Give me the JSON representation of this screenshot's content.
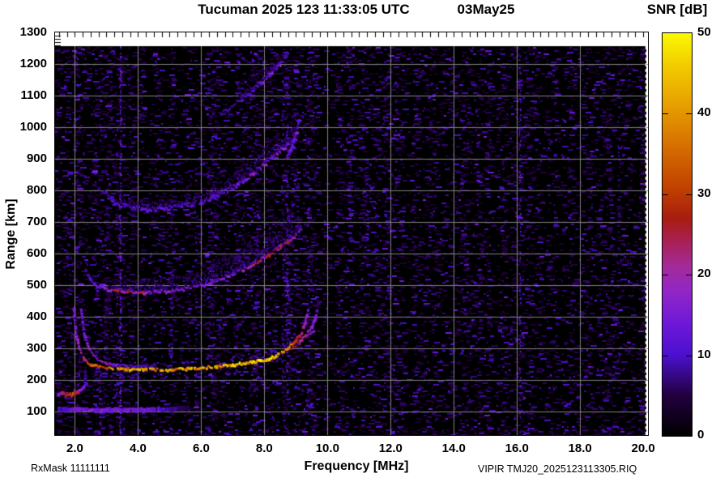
{
  "chart_data": {
    "type": "heatmap",
    "subtype": "ionogram",
    "title": "Tucuman 2025 123 11:33:05 UTC",
    "date_label": "03May25",
    "xlabel": "Frequency [MHz]",
    "ylabel": "Range [km]",
    "xlim": [
      1.372,
      20.15
    ],
    "ylim": [
      25.6,
      1300
    ],
    "data_top_km": 1256,
    "data_right_mhz": 20.08,
    "x_ticks": {
      "values": [
        2,
        4,
        6,
        8,
        10,
        12,
        14,
        16,
        18,
        20
      ],
      "labels": [
        "2.0",
        "4.0",
        "6.0",
        "8.0",
        "10.0",
        "12.0",
        "14.0",
        "16.0",
        "18.0",
        "20.0"
      ]
    },
    "y_ticks": {
      "values": [
        100,
        200,
        300,
        400,
        500,
        600,
        700,
        800,
        900,
        1000,
        1100,
        1200,
        1300
      ]
    },
    "x_gridlines": [
      2,
      4,
      6,
      8,
      10,
      12,
      14,
      16,
      18
    ],
    "y_gridlines": [
      100,
      200,
      300,
      400,
      500,
      600,
      700,
      800,
      900,
      1000,
      1100,
      1200
    ],
    "grid_color": "#818181",
    "bg_color": "#000000",
    "frame_color": "#000000",
    "right_edge_dash_color": "#ffffff",
    "notes": {
      "rx_mask": "RxMask 11111111",
      "file_label": "VIPIR  TMJ20_2025123113305.RIQ"
    },
    "colorbar": {
      "title": "SNR [dB]",
      "min": 0,
      "max": 50,
      "tick_values": [
        0,
        10,
        20,
        30,
        40,
        50
      ],
      "marked_ticks": [
        10,
        20,
        30,
        40
      ],
      "palette": [
        [
          0.0,
          "#000000"
        ],
        [
          0.1,
          "#22003e"
        ],
        [
          0.2,
          "#4c10ce"
        ],
        [
          0.28,
          "#6f18d8"
        ],
        [
          0.36,
          "#9226c6"
        ],
        [
          0.42,
          "#a42b9a"
        ],
        [
          0.48,
          "#a82158"
        ],
        [
          0.54,
          "#a81c10"
        ],
        [
          0.62,
          "#c24300"
        ],
        [
          0.72,
          "#d66f00"
        ],
        [
          0.82,
          "#e69e00"
        ],
        [
          0.92,
          "#f2cc00"
        ],
        [
          1.0,
          "#fbf800"
        ]
      ]
    },
    "traces": [
      {
        "name": "F-1hop-O-mode",
        "thickness": 3,
        "jitter": 3,
        "halo": true,
        "points": [
          [
            1.98,
            425
          ],
          [
            2.05,
            345
          ],
          [
            2.15,
            298
          ],
          [
            2.3,
            266
          ],
          [
            2.5,
            249
          ],
          [
            2.8,
            241
          ],
          [
            3.2,
            236
          ],
          [
            4.0,
            233
          ],
          [
            5.0,
            233
          ],
          [
            5.8,
            236
          ],
          [
            6.5,
            242
          ],
          [
            7.0,
            248
          ],
          [
            7.5,
            255
          ],
          [
            8.0,
            262
          ],
          [
            8.4,
            276
          ],
          [
            8.7,
            296
          ],
          [
            9.0,
            322
          ],
          [
            9.2,
            352
          ],
          [
            9.32,
            388
          ],
          [
            9.4,
            422
          ]
        ],
        "snr": [
          [
            1.98,
            15
          ],
          [
            2.2,
            20
          ],
          [
            2.5,
            30
          ],
          [
            2.8,
            35
          ],
          [
            3.2,
            38
          ],
          [
            5.0,
            39
          ],
          [
            6.5,
            41
          ],
          [
            7.3,
            44
          ],
          [
            8.0,
            44
          ],
          [
            8.5,
            42
          ],
          [
            8.8,
            37
          ],
          [
            9.0,
            29
          ],
          [
            9.2,
            23
          ],
          [
            9.4,
            17
          ]
        ],
        "spots": [
          [
            3.4,
            40
          ],
          [
            4.2,
            41
          ],
          [
            5.6,
            41
          ],
          [
            7.6,
            46
          ],
          [
            8.0,
            46
          ],
          [
            8.3,
            45
          ]
        ]
      },
      {
        "name": "F-1hop-X-low",
        "thickness": 2,
        "jitter": 2,
        "halo": false,
        "points": [
          [
            2.2,
            425
          ],
          [
            2.3,
            345
          ],
          [
            2.45,
            298
          ],
          [
            2.65,
            270
          ],
          [
            2.9,
            254
          ],
          [
            3.3,
            247
          ],
          [
            3.9,
            244
          ],
          [
            4.6,
            243
          ]
        ],
        "snr": [
          [
            2.2,
            13
          ],
          [
            2.5,
            17
          ],
          [
            2.9,
            19
          ],
          [
            3.5,
            13
          ],
          [
            4.6,
            7
          ]
        ]
      },
      {
        "name": "F-1hop-X-high",
        "thickness": 2.5,
        "jitter": 2,
        "halo": false,
        "points": [
          [
            8.85,
            298
          ],
          [
            9.1,
            316
          ],
          [
            9.3,
            340
          ],
          [
            9.5,
            366
          ],
          [
            9.62,
            395
          ],
          [
            9.68,
            422
          ]
        ],
        "snr": [
          [
            8.85,
            26
          ],
          [
            9.2,
            24
          ],
          [
            9.5,
            18
          ],
          [
            9.68,
            13
          ]
        ]
      },
      {
        "name": "F-1hop-stub",
        "thickness": 2,
        "jitter": 2,
        "halo": false,
        "points": [
          [
            9.12,
            326
          ],
          [
            9.35,
            340
          ],
          [
            9.58,
            355
          ]
        ],
        "snr": [
          [
            9.12,
            20
          ],
          [
            9.58,
            16
          ]
        ]
      },
      {
        "name": "F-2hop",
        "thickness": 3,
        "jitter": 4,
        "halo": true,
        "points": [
          [
            2.35,
            548
          ],
          [
            2.5,
            515
          ],
          [
            2.7,
            497
          ],
          [
            3.0,
            487
          ],
          [
            3.5,
            480
          ],
          [
            4.2,
            477
          ],
          [
            5.0,
            481
          ],
          [
            5.5,
            488
          ],
          [
            6.0,
            498
          ],
          [
            6.5,
            513
          ],
          [
            7.0,
            533
          ],
          [
            7.5,
            558
          ],
          [
            8.0,
            586
          ],
          [
            8.5,
            620
          ],
          [
            8.9,
            650
          ],
          [
            9.15,
            672
          ]
        ],
        "snr": [
          [
            2.35,
            9
          ],
          [
            2.7,
            13
          ],
          [
            3.2,
            17
          ],
          [
            4.0,
            19
          ],
          [
            4.6,
            17
          ],
          [
            5.5,
            14
          ],
          [
            6.5,
            15
          ],
          [
            7.2,
            17
          ],
          [
            7.8,
            21
          ],
          [
            8.3,
            23
          ],
          [
            8.8,
            21
          ],
          [
            9.15,
            15
          ]
        ],
        "spots": [
          [
            3.3,
            26
          ],
          [
            3.7,
            27
          ],
          [
            4.1,
            26
          ],
          [
            7.7,
            28
          ],
          [
            8.1,
            28
          ],
          [
            8.45,
            27
          ],
          [
            8.7,
            26
          ]
        ],
        "spread": [
          [
            3.0,
            28
          ],
          [
            4.0,
            38
          ],
          [
            5.0,
            45
          ],
          [
            6.0,
            55
          ],
          [
            6.5,
            65
          ],
          [
            7.0,
            75
          ],
          [
            7.5,
            85
          ],
          [
            8.0,
            90
          ],
          [
            8.5,
            85
          ],
          [
            9.0,
            68
          ],
          [
            9.15,
            40
          ]
        ]
      },
      {
        "name": "F-3hop",
        "thickness": 3,
        "jitter": 5,
        "halo": false,
        "points": [
          [
            2.9,
            800
          ],
          [
            3.2,
            763
          ],
          [
            3.6,
            748
          ],
          [
            4.3,
            740
          ],
          [
            5.0,
            744
          ],
          [
            5.6,
            753
          ],
          [
            6.0,
            763
          ],
          [
            6.5,
            781
          ],
          [
            7.0,
            808
          ],
          [
            7.5,
            842
          ],
          [
            8.0,
            882
          ],
          [
            8.5,
            925
          ],
          [
            9.0,
            962
          ]
        ],
        "snr": [
          [
            2.9,
            8
          ],
          [
            3.5,
            11
          ],
          [
            4.5,
            13
          ],
          [
            5.5,
            11
          ],
          [
            6.5,
            12
          ],
          [
            7.5,
            14
          ],
          [
            8.3,
            15
          ],
          [
            9.0,
            11
          ]
        ],
        "spots": [
          [
            7.6,
            20
          ],
          [
            8.0,
            21
          ],
          [
            8.35,
            22
          ],
          [
            8.6,
            19
          ]
        ],
        "spread": [
          [
            3.2,
            18
          ],
          [
            5.0,
            26
          ],
          [
            6.5,
            38
          ],
          [
            7.5,
            52
          ],
          [
            8.3,
            60
          ],
          [
            9.0,
            42
          ]
        ]
      },
      {
        "name": "F-4hop",
        "thickness": 2.5,
        "jitter": 5,
        "halo": false,
        "points": [
          [
            6.6,
            1040
          ],
          [
            7.0,
            1068
          ],
          [
            7.4,
            1098
          ],
          [
            7.8,
            1132
          ],
          [
            8.2,
            1168
          ],
          [
            8.55,
            1205
          ],
          [
            8.72,
            1230
          ]
        ],
        "snr": [
          [
            6.6,
            7
          ],
          [
            7.2,
            9
          ],
          [
            7.8,
            12
          ],
          [
            8.3,
            13
          ],
          [
            8.72,
            9
          ]
        ],
        "spots": [
          [
            7.9,
            16
          ],
          [
            8.2,
            17
          ],
          [
            8.45,
            16
          ]
        ],
        "spread": [
          [
            7.2,
            18
          ],
          [
            8.0,
            32
          ],
          [
            8.6,
            28
          ]
        ]
      },
      {
        "name": "F-4hop-steep",
        "thickness": 2.5,
        "jitter": 4,
        "halo": false,
        "points": [
          [
            8.75,
            905
          ],
          [
            8.85,
            932
          ],
          [
            8.95,
            962
          ],
          [
            9.05,
            998
          ],
          [
            9.12,
            1025
          ]
        ],
        "snr": [
          [
            8.75,
            12
          ],
          [
            9.0,
            14
          ],
          [
            9.12,
            10
          ]
        ],
        "spots": [
          [
            9.0,
            16
          ]
        ]
      },
      {
        "name": "E-layer",
        "thickness": 5,
        "jitter": 2,
        "halo": false,
        "points": [
          [
            1.5,
            107
          ],
          [
            2.2,
            106
          ],
          [
            3.0,
            105
          ],
          [
            4.0,
            105
          ],
          [
            4.6,
            106
          ],
          [
            5.2,
            109
          ],
          [
            5.6,
            112
          ]
        ],
        "snr": [
          [
            1.5,
            10
          ],
          [
            1.8,
            13
          ],
          [
            2.2,
            15
          ],
          [
            3.0,
            14
          ],
          [
            3.8,
            14
          ],
          [
            4.5,
            12
          ],
          [
            5.0,
            8
          ],
          [
            5.6,
            5
          ]
        ],
        "spots": [
          [
            2.1,
            16
          ],
          [
            2.5,
            17
          ],
          [
            2.9,
            16
          ],
          [
            3.3,
            16
          ]
        ]
      },
      {
        "name": "low-freq-blob",
        "thickness": 4,
        "jitter": 3,
        "halo": true,
        "points": [
          [
            1.45,
            150
          ],
          [
            1.6,
            158
          ],
          [
            1.75,
            154
          ],
          [
            1.9,
            152
          ],
          [
            2.0,
            158
          ],
          [
            2.1,
            165
          ],
          [
            2.2,
            172
          ],
          [
            2.3,
            183
          ],
          [
            2.36,
            192
          ]
        ],
        "snr": [
          [
            1.45,
            13
          ],
          [
            1.6,
            20
          ],
          [
            1.75,
            26
          ],
          [
            1.95,
            30
          ],
          [
            2.05,
            24
          ],
          [
            2.2,
            16
          ],
          [
            2.36,
            11
          ]
        ]
      },
      {
        "name": "blob-tail",
        "thickness": 2,
        "jitter": 2,
        "halo": false,
        "points": [
          [
            2.32,
            192
          ],
          [
            2.34,
            212
          ],
          [
            2.33,
            230
          ]
        ],
        "snr": [
          [
            2.32,
            10
          ],
          [
            2.33,
            8
          ]
        ]
      }
    ],
    "rfi_columns": [
      {
        "f": 2.78,
        "km": [
          60,
          230
        ],
        "prob": 0.4,
        "snr": 11,
        "width": 2
      },
      {
        "f": 2.9,
        "km": [
          60,
          600
        ],
        "prob": 0.15,
        "snr": 8,
        "width": 2
      },
      {
        "f": 3.42,
        "km": [
          30,
          1256
        ],
        "prob": 0.55,
        "snr": 13,
        "width": 2
      },
      {
        "f": 3.32,
        "km": [
          100,
          1100
        ],
        "prob": 0.16,
        "snr": 8,
        "width": 2
      },
      {
        "f": 4.35,
        "km": [
          150,
          900
        ],
        "prob": 0.14,
        "snr": 8,
        "width": 2
      },
      {
        "f": 5.05,
        "km": [
          150,
          800
        ],
        "prob": 0.14,
        "snr": 8,
        "width": 2
      },
      {
        "f": 5.8,
        "km": [
          150,
          900
        ],
        "prob": 0.17,
        "snr": 9,
        "width": 2
      },
      {
        "f": 6.3,
        "km": [
          300,
          1000
        ],
        "prob": 0.12,
        "snr": 8,
        "width": 2
      },
      {
        "f": 7.3,
        "km": [
          300,
          1150
        ],
        "prob": 0.12,
        "snr": 8,
        "width": 2
      },
      {
        "f": 8.55,
        "km": [
          150,
          1250
        ],
        "prob": 0.2,
        "snr": 10,
        "width": 2
      },
      {
        "f": 8.7,
        "km": [
          150,
          1250
        ],
        "prob": 0.28,
        "snr": 11,
        "width": 2
      },
      {
        "f": 9.37,
        "km": [
          150,
          1100
        ],
        "prob": 0.17,
        "snr": 9,
        "width": 2
      },
      {
        "f": 10.65,
        "km": [
          550,
          980
        ],
        "prob": 0.35,
        "snr": 10,
        "width": 5
      },
      {
        "f": 11.2,
        "km": [
          580,
          920
        ],
        "prob": 0.25,
        "snr": 9,
        "width": 4
      },
      {
        "f": 12.15,
        "km": [
          800,
          1170
        ],
        "prob": 0.22,
        "snr": 9,
        "width": 3
      },
      {
        "f": 13.9,
        "km": [
          150,
          1250
        ],
        "prob": 0.1,
        "snr": 7,
        "width": 2
      },
      {
        "f": 16.08,
        "km": [
          80,
          1256
        ],
        "prob": 0.45,
        "snr": 12,
        "width": 1.5
      },
      {
        "f": 18.35,
        "km": [
          80,
          1250
        ],
        "prob": 0.14,
        "snr": 8,
        "width": 2
      },
      {
        "f": 19.2,
        "km": [
          100,
          1250
        ],
        "prob": 0.12,
        "snr": 8,
        "width": 2
      }
    ],
    "noise": {
      "base_prob": 0.32,
      "left_boost": 1.12,
      "right_base": 0.92,
      "dark_col_prob": 0.055,
      "bottom_band_km": 45,
      "bottom_boost": 1.9
    }
  }
}
